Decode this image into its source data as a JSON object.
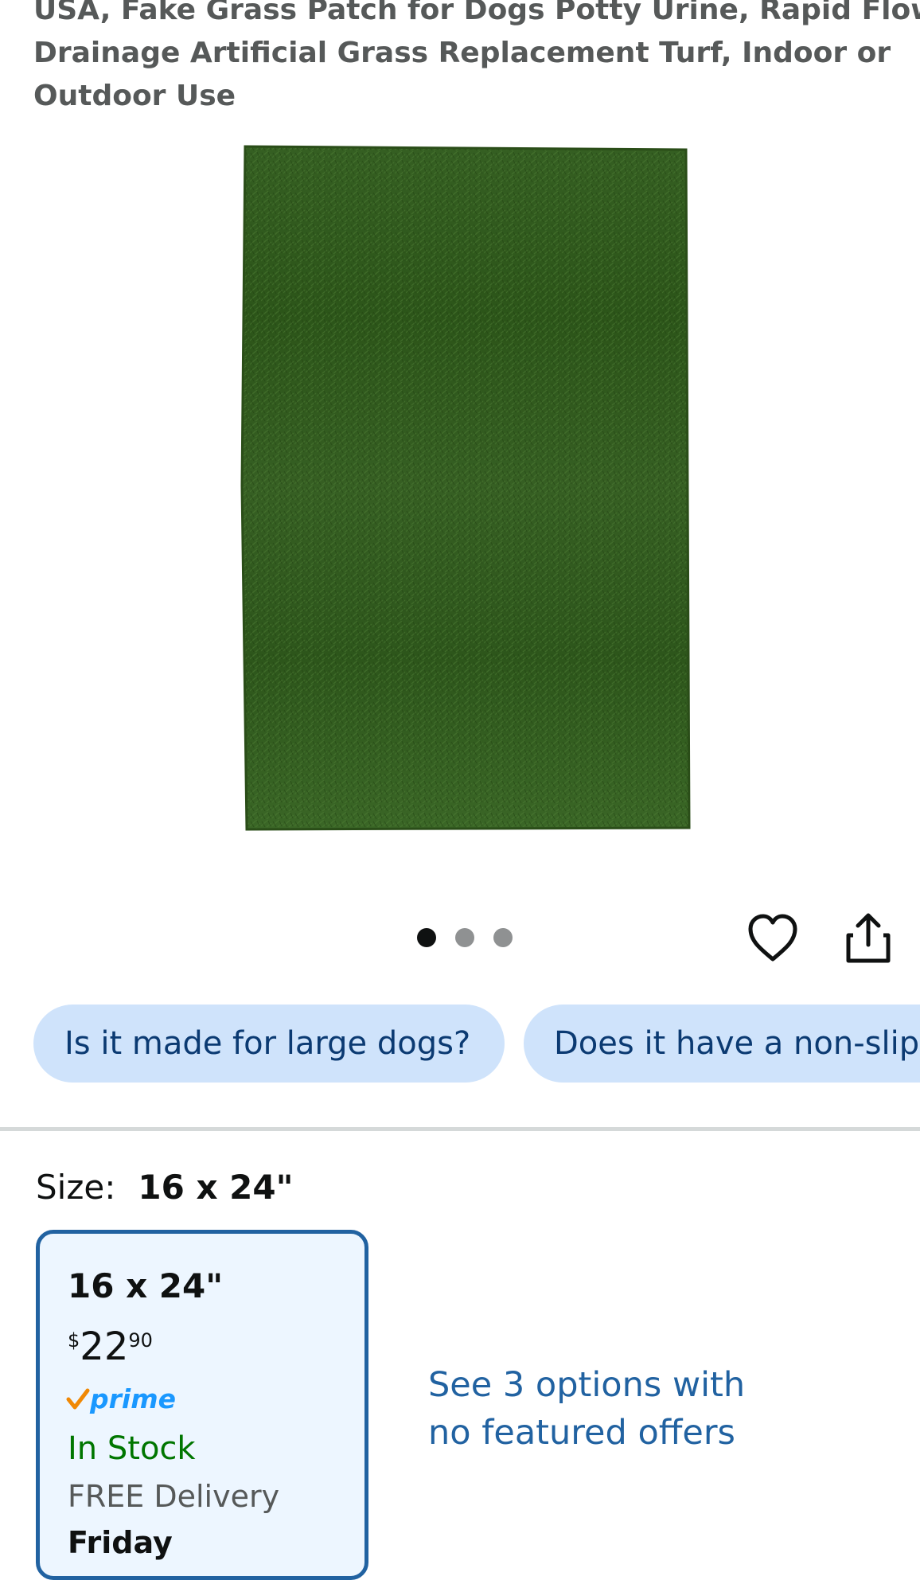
{
  "product": {
    "title_lines": [
      "USA, Fake Grass Patch for Dogs Potty Urine, Rapid Flow",
      "Drainage Artificial Grass Replacement Turf, Indoor or",
      "Outdoor Use"
    ],
    "image_count": 3,
    "active_image_index": 0
  },
  "chips": [
    {
      "label": "Is it made for large dogs?"
    },
    {
      "label": "Does it have a non-slip"
    }
  ],
  "size": {
    "label": "Size:",
    "selected": "16 x 24\""
  },
  "option": {
    "size": "16 x 24\"",
    "currency": "$",
    "price_whole": "22",
    "price_fraction": "90",
    "prime": "prime",
    "stock": "In Stock",
    "delivery": "FREE Delivery",
    "day": "Friday"
  },
  "more_options": {
    "lines": [
      "See 3 options with",
      "no featured offers"
    ]
  },
  "colors": {
    "chip_bg": "#cfe3fb",
    "chip_text": "#0b3a72",
    "card_border": "#2162a1",
    "card_bg": "#edf6ff",
    "link": "#2162a1",
    "in_stock": "#007600",
    "prime_blue": "#1a98ff",
    "prime_check": "#f08804",
    "grass": "#2f5a1e"
  },
  "icons": {
    "wishlist": "heart-icon",
    "share": "share-icon",
    "prime": "prime-check-icon"
  }
}
